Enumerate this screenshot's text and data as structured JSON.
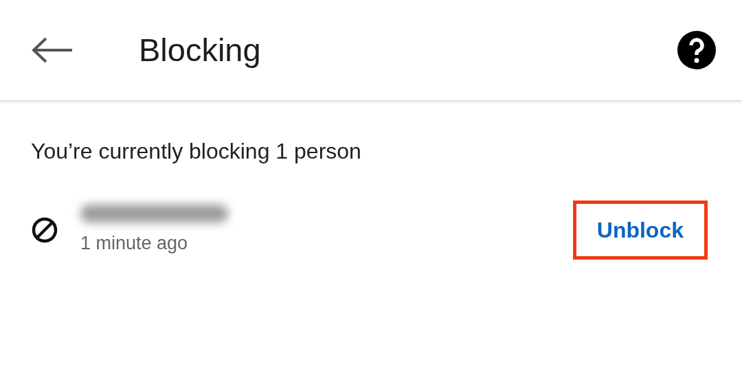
{
  "header": {
    "title": "Blocking"
  },
  "summary": "You’re currently blocking 1 person",
  "blocked_people": [
    {
      "time": "1 minute ago",
      "action": "Unblock",
      "highlighted": true
    }
  ]
}
